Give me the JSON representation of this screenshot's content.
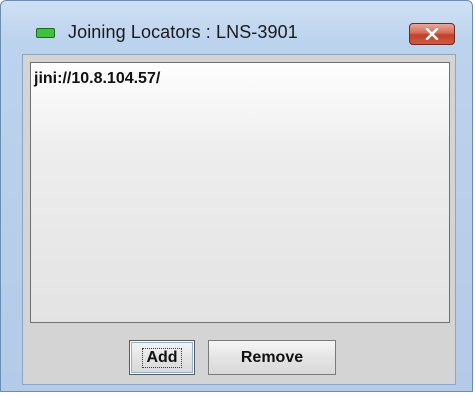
{
  "window": {
    "title": "Joining Locators : LNS-3901",
    "app_icon": "green-rectangle-icon",
    "close_icon": "close-icon"
  },
  "locators": [
    "jini://10.8.104.57/"
  ],
  "buttons": {
    "add_label": "Add",
    "remove_label": "Remove"
  },
  "colors": {
    "titlebar": "#bcd3ee",
    "close_button": "#c1402a",
    "app_icon": "#3ec23e",
    "panel": "#d4d4d4"
  }
}
